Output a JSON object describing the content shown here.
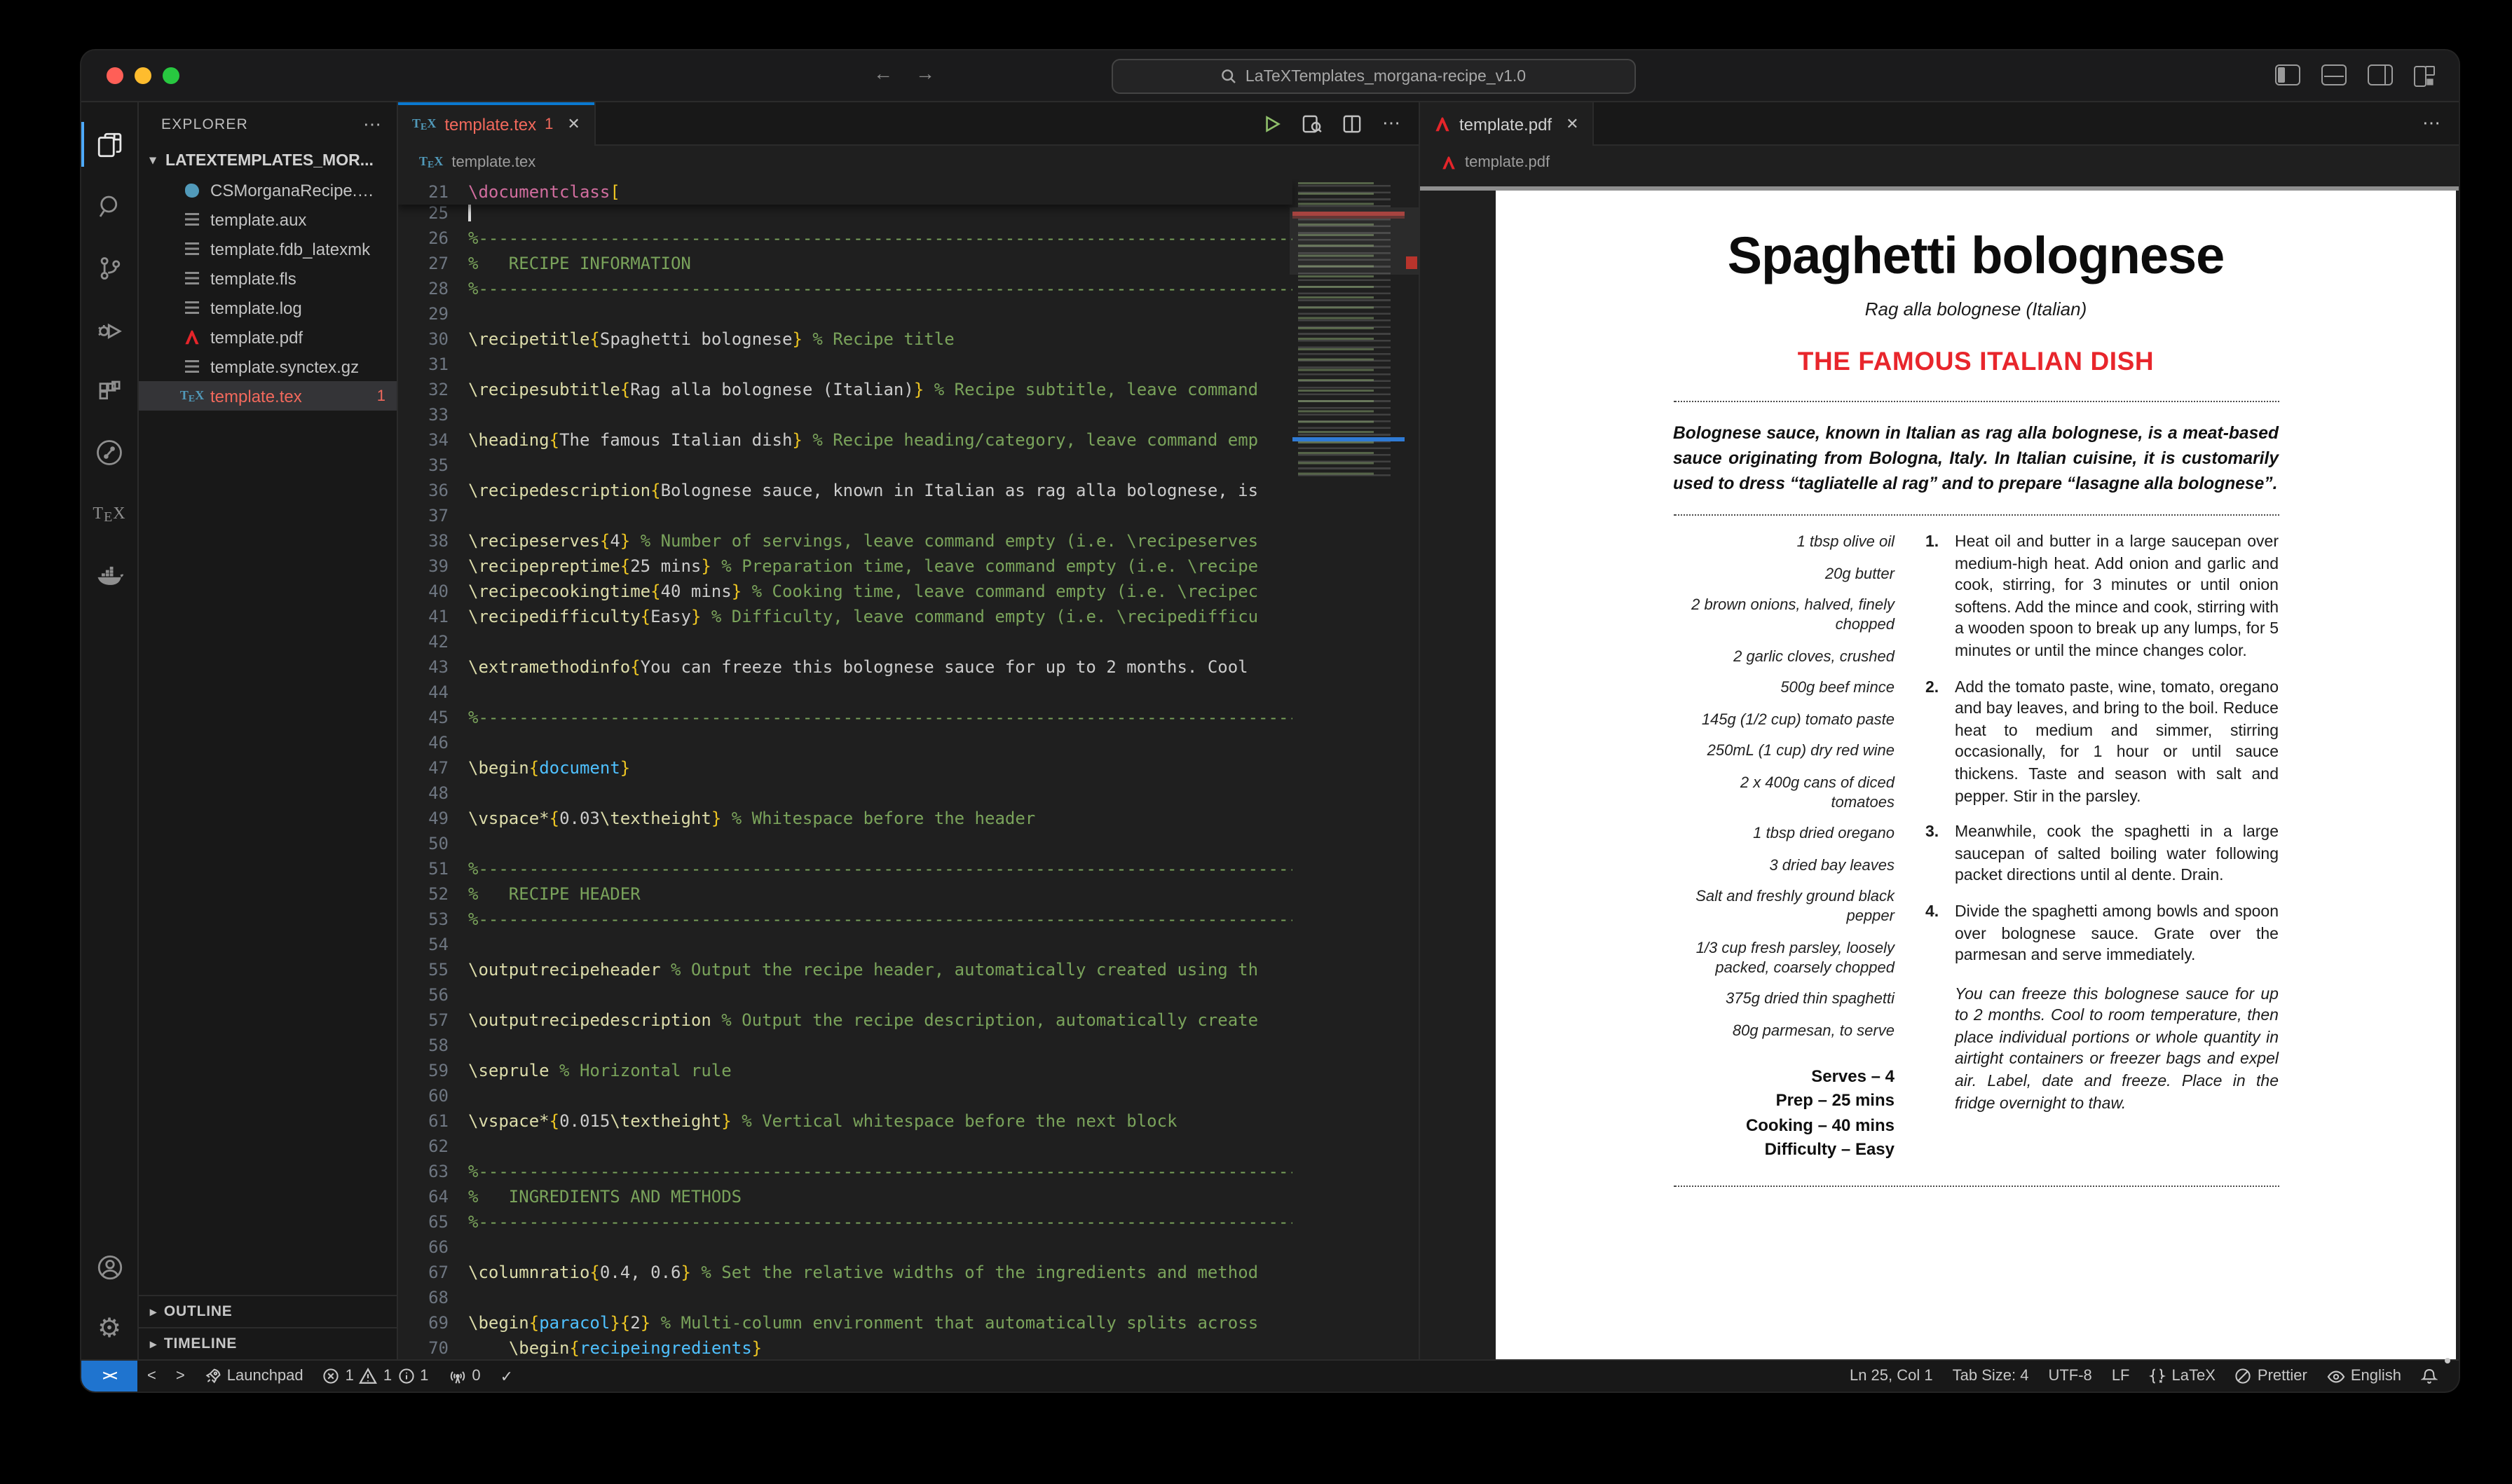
{
  "titlebar": {
    "search": "LaTeXTemplates_morgana-recipe_v1.0"
  },
  "explorer": {
    "title": "EXPLORER",
    "folder": "LATEXTEMPLATES_MOR...",
    "files": [
      {
        "name": "CSMorganaRecipe.cls",
        "icon": "cls",
        "badge": ""
      },
      {
        "name": "template.aux",
        "icon": "txt",
        "badge": ""
      },
      {
        "name": "template.fdb_latexmk",
        "icon": "txt",
        "badge": ""
      },
      {
        "name": "template.fls",
        "icon": "txt",
        "badge": ""
      },
      {
        "name": "template.log",
        "icon": "txt",
        "badge": ""
      },
      {
        "name": "template.pdf",
        "icon": "pdf",
        "badge": ""
      },
      {
        "name": "template.synctex.gz",
        "icon": "txt",
        "badge": ""
      },
      {
        "name": "template.tex",
        "icon": "tex",
        "badge": "1",
        "selected": true,
        "error": true
      }
    ],
    "sections": [
      {
        "label": "OUTLINE"
      },
      {
        "label": "TIMELINE"
      }
    ]
  },
  "editor": {
    "tab": {
      "label": "template.tex",
      "badge": "1"
    },
    "breadcrumb": "template.tex",
    "sticky_line": {
      "n": "21",
      "segs": [
        [
          "cmd2",
          "\\documentclass"
        ],
        [
          "brace",
          "["
        ]
      ]
    },
    "lines": [
      {
        "n": "25",
        "segs": [
          [
            "cur",
            ""
          ]
        ]
      },
      {
        "n": "26",
        "segs": [
          [
            "com",
            "%---------------------------------------------------------------------------------------------------"
          ]
        ]
      },
      {
        "n": "27",
        "segs": [
          [
            "com",
            "%   RECIPE INFORMATION"
          ]
        ]
      },
      {
        "n": "28",
        "segs": [
          [
            "com",
            "%---------------------------------------------------------------------------------------------------"
          ]
        ]
      },
      {
        "n": "29",
        "segs": []
      },
      {
        "n": "30",
        "segs": [
          [
            "cmd",
            "\\recipetitle"
          ],
          [
            "brace",
            "{"
          ],
          [
            "txt",
            "Spaghetti bolognese"
          ],
          [
            "brace",
            "}"
          ],
          [
            "com",
            " % Recipe title"
          ]
        ]
      },
      {
        "n": "31",
        "segs": []
      },
      {
        "n": "32",
        "segs": [
          [
            "cmd",
            "\\recipesubtitle"
          ],
          [
            "brace",
            "{"
          ],
          [
            "txt",
            "Rag alla bolognese (Italian)"
          ],
          [
            "brace",
            "}"
          ],
          [
            "com",
            " % Recipe subtitle, leave command"
          ]
        ]
      },
      {
        "n": "33",
        "segs": []
      },
      {
        "n": "34",
        "segs": [
          [
            "cmd",
            "\\heading"
          ],
          [
            "brace",
            "{"
          ],
          [
            "txt",
            "The famous Italian dish"
          ],
          [
            "brace",
            "}"
          ],
          [
            "com",
            " % Recipe heading/category, leave command emp"
          ]
        ]
      },
      {
        "n": "35",
        "segs": []
      },
      {
        "n": "36",
        "segs": [
          [
            "cmd",
            "\\recipedescription"
          ],
          [
            "brace",
            "{"
          ],
          [
            "txt",
            "Bolognese sauce, known in Italian as rag alla bolognese, is"
          ]
        ]
      },
      {
        "n": "37",
        "segs": []
      },
      {
        "n": "38",
        "segs": [
          [
            "cmd",
            "\\recipeserves"
          ],
          [
            "brace",
            "{"
          ],
          [
            "txt",
            "4"
          ],
          [
            "brace",
            "}"
          ],
          [
            "com",
            " % Number of servings, leave command empty (i.e. \\recipeserves"
          ]
        ]
      },
      {
        "n": "39",
        "segs": [
          [
            "cmd",
            "\\recipepreptime"
          ],
          [
            "brace",
            "{"
          ],
          [
            "txt",
            "25 mins"
          ],
          [
            "brace",
            "}"
          ],
          [
            "com",
            " % Preparation time, leave command empty (i.e. \\recipe"
          ]
        ]
      },
      {
        "n": "40",
        "segs": [
          [
            "cmd",
            "\\recipecookingtime"
          ],
          [
            "brace",
            "{"
          ],
          [
            "txt",
            "40 mins"
          ],
          [
            "brace",
            "}"
          ],
          [
            "com",
            " % Cooking time, leave command empty (i.e. \\recipec"
          ]
        ]
      },
      {
        "n": "41",
        "segs": [
          [
            "cmd",
            "\\recipedifficulty"
          ],
          [
            "brace",
            "{"
          ],
          [
            "txt",
            "Easy"
          ],
          [
            "brace",
            "}"
          ],
          [
            "com",
            " % Difficulty, leave command empty (i.e. \\recipedifficu"
          ]
        ]
      },
      {
        "n": "42",
        "segs": []
      },
      {
        "n": "43",
        "segs": [
          [
            "cmd",
            "\\extramethodinfo"
          ],
          [
            "brace",
            "{"
          ],
          [
            "txt",
            "You can freeze this bolognese sauce for up to 2 months. Cool"
          ]
        ]
      },
      {
        "n": "44",
        "segs": []
      },
      {
        "n": "45",
        "segs": [
          [
            "com",
            "%---------------------------------------------------------------------------------------------------"
          ]
        ]
      },
      {
        "n": "46",
        "segs": []
      },
      {
        "n": "47",
        "segs": [
          [
            "cmd",
            "\\begin"
          ],
          [
            "brace",
            "{"
          ],
          [
            "env",
            "document"
          ],
          [
            "brace",
            "}"
          ]
        ]
      },
      {
        "n": "48",
        "segs": []
      },
      {
        "n": "49",
        "segs": [
          [
            "cmd",
            "\\vspace*"
          ],
          [
            "brace",
            "{"
          ],
          [
            "txt",
            "0.03"
          ],
          [
            "cmd",
            "\\textheight"
          ],
          [
            "brace",
            "}"
          ],
          [
            "com",
            " % Whitespace before the header"
          ]
        ]
      },
      {
        "n": "50",
        "segs": []
      },
      {
        "n": "51",
        "segs": [
          [
            "com",
            "%---------------------------------------------------------------------------------------------------"
          ]
        ]
      },
      {
        "n": "52",
        "segs": [
          [
            "com",
            "%   RECIPE HEADER"
          ]
        ]
      },
      {
        "n": "53",
        "segs": [
          [
            "com",
            "%---------------------------------------------------------------------------------------------------"
          ]
        ]
      },
      {
        "n": "54",
        "segs": []
      },
      {
        "n": "55",
        "segs": [
          [
            "cmd",
            "\\outputrecipeheader"
          ],
          [
            "com",
            " % Output the recipe header, automatically created using th"
          ]
        ]
      },
      {
        "n": "56",
        "segs": []
      },
      {
        "n": "57",
        "segs": [
          [
            "cmd",
            "\\outputrecipedescription"
          ],
          [
            "com",
            " % Output the recipe description, automatically create"
          ]
        ]
      },
      {
        "n": "58",
        "segs": []
      },
      {
        "n": "59",
        "segs": [
          [
            "cmd",
            "\\seprule"
          ],
          [
            "com",
            " % Horizontal rule"
          ]
        ]
      },
      {
        "n": "60",
        "segs": []
      },
      {
        "n": "61",
        "segs": [
          [
            "cmd",
            "\\vspace*"
          ],
          [
            "brace",
            "{"
          ],
          [
            "txt",
            "0.015"
          ],
          [
            "cmd",
            "\\textheight"
          ],
          [
            "brace",
            "}"
          ],
          [
            "com",
            " % Vertical whitespace before the next block"
          ]
        ]
      },
      {
        "n": "62",
        "segs": []
      },
      {
        "n": "63",
        "segs": [
          [
            "com",
            "%---------------------------------------------------------------------------------------------------"
          ]
        ]
      },
      {
        "n": "64",
        "segs": [
          [
            "com",
            "%   INGREDIENTS AND METHODS"
          ]
        ]
      },
      {
        "n": "65",
        "segs": [
          [
            "com",
            "%---------------------------------------------------------------------------------------------------"
          ]
        ]
      },
      {
        "n": "66",
        "segs": []
      },
      {
        "n": "67",
        "segs": [
          [
            "cmd",
            "\\columnratio"
          ],
          [
            "brace",
            "{"
          ],
          [
            "txt",
            "0.4, 0.6"
          ],
          [
            "brace",
            "}"
          ],
          [
            "com",
            " % Set the relative widths of the ingredients and method"
          ]
        ]
      },
      {
        "n": "68",
        "segs": []
      },
      {
        "n": "69",
        "segs": [
          [
            "cmd",
            "\\begin"
          ],
          [
            "brace",
            "{"
          ],
          [
            "env",
            "paracol"
          ],
          [
            "brace",
            "}{"
          ],
          [
            "txt",
            "2"
          ],
          [
            "brace",
            "}"
          ],
          [
            "com",
            " % Multi-column environment that automatically splits across"
          ]
        ]
      },
      {
        "n": "70",
        "segs": [
          [
            "txt",
            "    "
          ],
          [
            "cmd",
            "\\begin"
          ],
          [
            "brace",
            "{"
          ],
          [
            "env",
            "recipeingredients"
          ],
          [
            "brace",
            "}"
          ]
        ]
      }
    ]
  },
  "pdf": {
    "tab": "template.pdf",
    "breadcrumb": "template.pdf",
    "title": "Spaghetti bolognese",
    "subtitle": "Rag alla bolognese (Italian)",
    "heading": "THE FAMOUS ITALIAN DISH",
    "description": "Bolognese sauce, known in Italian as rag alla bolognese, is a meat-based sauce originating from Bologna, Italy.  In Italian cuisine, it is customarily used to dress “tagliatelle al rag” and to prepare “lasagne alla bolognese”.",
    "ingredients": [
      "1 tbsp olive oil",
      "20g butter",
      "2 brown onions, halved, finely chopped",
      "2 garlic cloves, crushed",
      "500g beef mince",
      "145g (1/2 cup) tomato paste",
      "250mL (1 cup) dry red wine",
      "2 x 400g cans of diced tomatoes",
      "1 tbsp dried oregano",
      "3 dried bay leaves",
      "Salt and freshly ground black pepper",
      "1/3 cup fresh parsley, loosely packed, coarsely chopped",
      "375g dried thin spaghetti",
      "80g parmesan, to serve"
    ],
    "facts": [
      "Serves – 4",
      "Prep – 25 mins",
      "Cooking – 40 mins",
      "Difficulty – Easy"
    ],
    "methods": [
      "Heat oil and butter in a large saucepan over medium-high heat.  Add onion and garlic and cook, stirring, for 3 minutes or until onion softens.  Add the mince and cook, stirring with a wooden spoon to break up any lumps, for 5 minutes or until the mince changes color.",
      "Add the tomato paste, wine, tomato, oregano and bay leaves, and bring to the boil. Reduce heat to medium and simmer, stirring occasionally, for 1 hour or until sauce thickens.  Taste and season with salt and pepper. Stir in the parsley.",
      "Meanwhile, cook the spaghetti in a large saucepan of salted boiling water following packet directions until al dente. Drain.",
      "Divide the spaghetti among bowls and spoon over bolognese sauce. Grate over the parmesan and serve immediately."
    ],
    "note": "You can freeze this bolognese sauce for up to 2 months.  Cool to room temperature, then place individual portions or whole quantity in airtight containers or freezer bags and expel air.  Label, date and freeze. Place in the fridge overnight to thaw."
  },
  "statusbar": {
    "launchpad": "Launchpad",
    "errors": "1",
    "warnings": "1",
    "infos": "1",
    "ports": "0",
    "line_col": "Ln 25, Col 1",
    "tab_size": "Tab Size: 4",
    "encoding": "UTF-8",
    "eol": "LF",
    "language": "LaTeX",
    "formatter": "Prettier",
    "spell": "English"
  }
}
